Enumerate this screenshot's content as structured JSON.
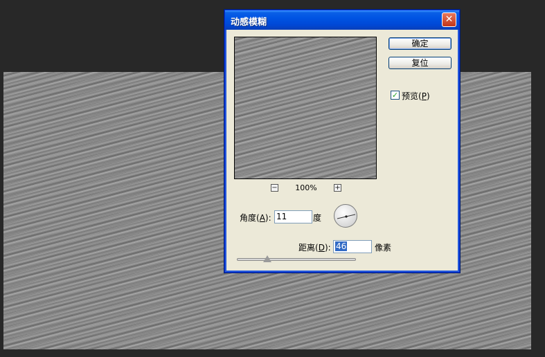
{
  "dialog": {
    "title": "动感模糊",
    "close_label": "✕",
    "ok_label": "确定",
    "reset_label": "复位",
    "preview_label": "预览",
    "preview_hotkey": "P",
    "preview_checked": true,
    "checkbox_mark": "✓",
    "zoom": {
      "minus": "−",
      "plus": "+",
      "level": "100%"
    },
    "angle": {
      "label": "角度",
      "hotkey": "A",
      "value": "11",
      "unit": "度"
    },
    "distance": {
      "label": "距离",
      "hotkey": "D",
      "value": "46",
      "unit": "像素"
    }
  },
  "colors": {
    "background": "#282828",
    "titlebar": "#0054e3",
    "dialog_face": "#ece9d8",
    "selection": "#316ac5"
  }
}
